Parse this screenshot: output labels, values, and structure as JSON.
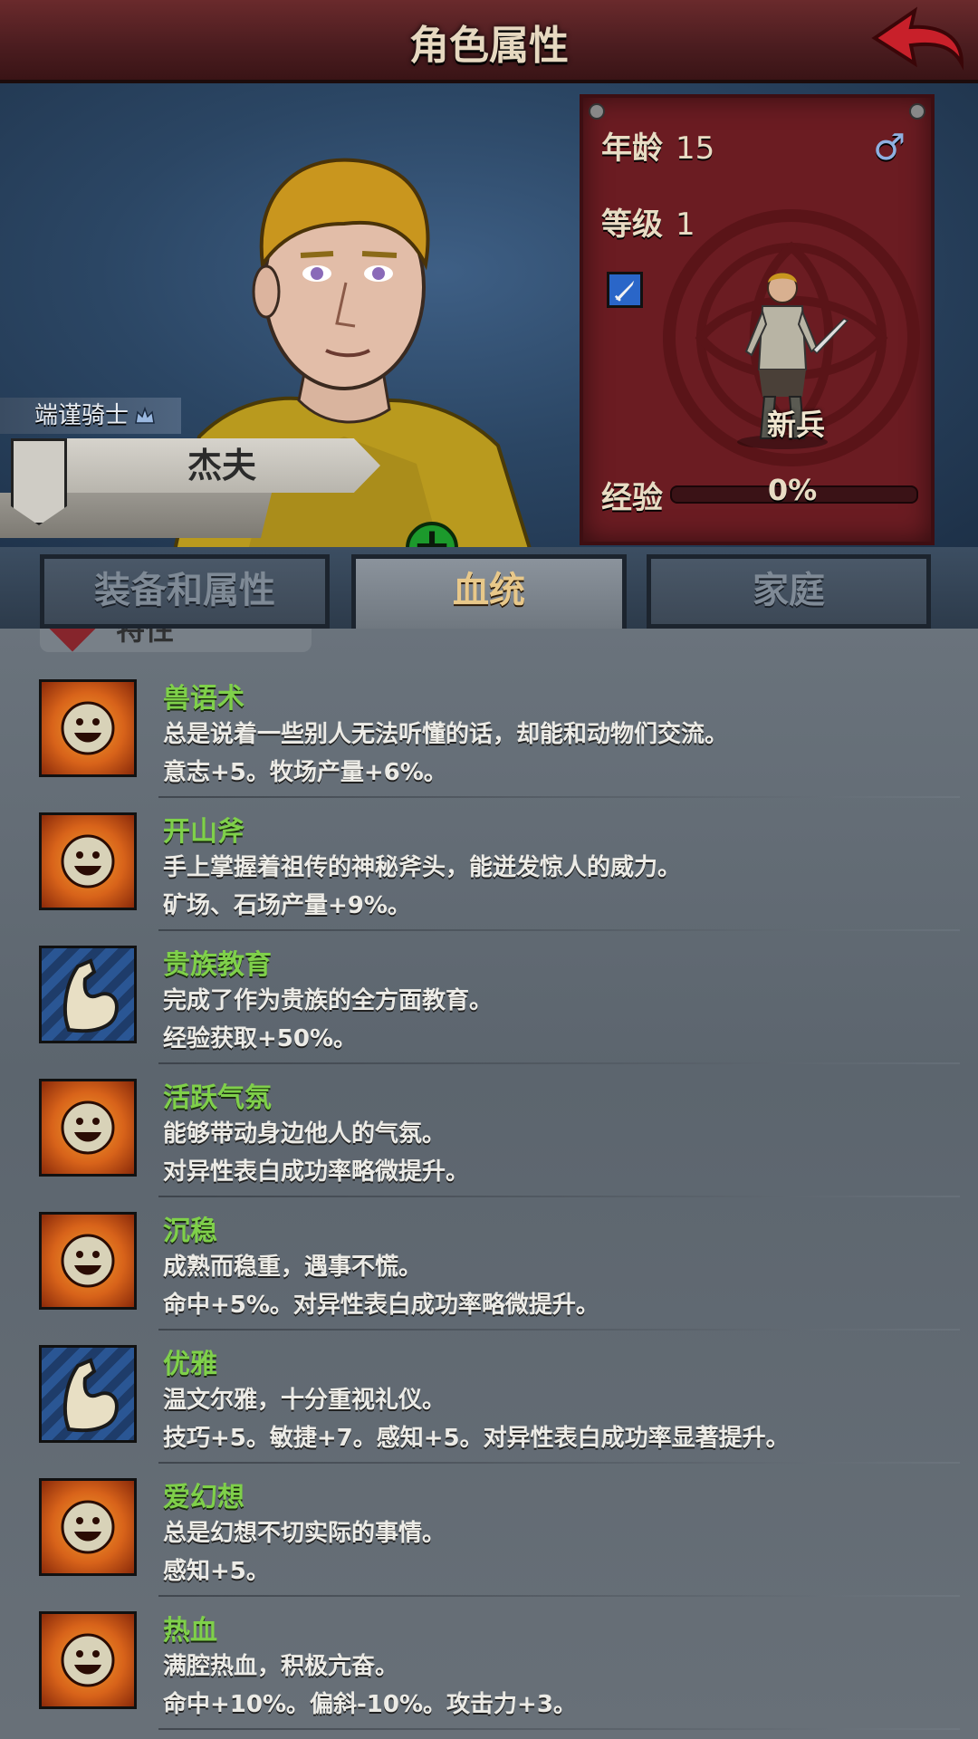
{
  "header": {
    "title": "角色属性",
    "back_icon": "back-arrow-icon",
    "accent_color": "#c8202a"
  },
  "character": {
    "rank": "端谨骑士",
    "name": "杰夫",
    "age_label": "年龄",
    "age": "15",
    "level_label": "等级",
    "level": "1",
    "gender_symbol": "♂",
    "weapon_icon": "dagger-icon",
    "class_name": "新兵",
    "exp_label": "经验",
    "exp_percent": "0%",
    "exp_fraction": 0
  },
  "tabs": [
    {
      "label": "装备和属性",
      "active": false
    },
    {
      "label": "血统",
      "active": true
    },
    {
      "label": "家庭",
      "active": false
    }
  ],
  "section": {
    "title": "特性"
  },
  "traits": [
    {
      "name": "兽语术",
      "icon": "smile-icon",
      "description": "总是说着一些别人无法听懂的话，却能和动物们交流。",
      "effect": "意志+5。牧场产量+6%。"
    },
    {
      "name": "开山斧",
      "icon": "smile-icon",
      "description": "手上掌握着祖传的神秘斧头，能迸发惊人的威力。",
      "effect": "矿场、石场产量+9%。"
    },
    {
      "name": "贵族教育",
      "icon": "arm-icon",
      "description": "完成了作为贵族的全方面教育。",
      "effect": "经验获取+50%。"
    },
    {
      "name": "活跃气氛",
      "icon": "smile-icon",
      "description": "能够带动身边他人的气氛。",
      "effect": "对异性表白成功率略微提升。"
    },
    {
      "name": "沉稳",
      "icon": "smile-icon",
      "description": "成熟而稳重，遇事不慌。",
      "effect": "命中+5%。对异性表白成功率略微提升。"
    },
    {
      "name": "优雅",
      "icon": "arm-icon",
      "description": "温文尔雅，十分重视礼仪。",
      "effect": "技巧+5。敏捷+7。感知+5。对异性表白成功率显著提升。"
    },
    {
      "name": "爱幻想",
      "icon": "smile-icon",
      "description": "总是幻想不切实际的事情。",
      "effect": "感知+5。"
    },
    {
      "name": "热血",
      "icon": "smile-icon",
      "description": "满腔热血，积极亢奋。",
      "effect": "命中+10%。偏斜-10%。攻击力+3。"
    }
  ]
}
